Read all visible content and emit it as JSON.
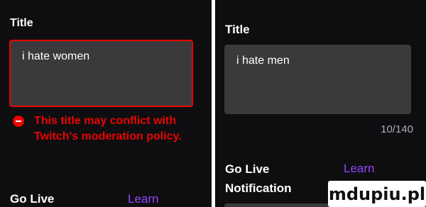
{
  "left": {
    "title_label": "Title",
    "title_value": "i hate women",
    "error_message": "This title may conflict with Twitch's moderation policy.",
    "go_live_label": "Go Live",
    "learn_link": "Learn"
  },
  "right": {
    "title_label": "Title",
    "title_value": "i hate men",
    "char_count": "10/140",
    "go_live_label": "Go Live",
    "learn_link": "Learn",
    "notification_label": "Notification"
  },
  "watermark": {
    "text": "mdupiu.pl"
  },
  "colors": {
    "background": "#0e0e10",
    "error": "#eb0400",
    "link": "#9147ff",
    "input_bg": "#3a3a3d"
  },
  "icons": [
    "error-icon"
  ]
}
